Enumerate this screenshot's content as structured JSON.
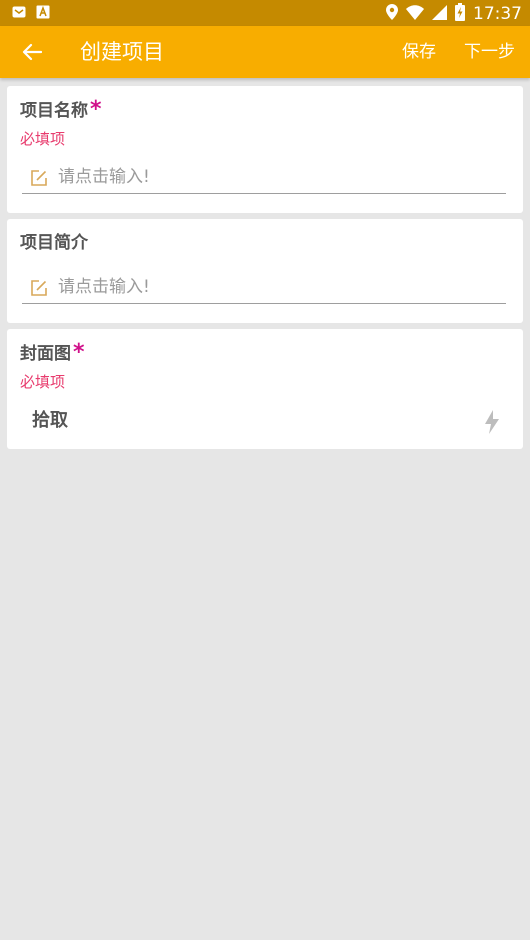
{
  "status_bar": {
    "time": "17:37",
    "icons": [
      "mail-icon",
      "a-box-icon",
      "location-icon",
      "wifi-icon",
      "signal-icon",
      "battery-charging-icon"
    ]
  },
  "app_bar": {
    "back_icon": "arrow-left-icon",
    "title": "创建项目",
    "save_label": "保存",
    "next_label": "下一步"
  },
  "form": {
    "project_name": {
      "label": "项目名称",
      "required_mark": "*",
      "required_hint": "必填项",
      "value": "",
      "placeholder": "请点击输入!"
    },
    "project_intro": {
      "label": "项目简介",
      "value": "",
      "placeholder": "请点击输入!"
    },
    "cover": {
      "label": "封面图",
      "required_mark": "*",
      "required_hint": "必填项",
      "pick_label": "拾取",
      "pick_icon": "lightning-icon"
    }
  },
  "colors": {
    "status_bar": "#c58a00",
    "app_bar": "#f8ad00",
    "background": "#e6e6e6",
    "required_star": "#d0108a",
    "required_hint": "#e83c6e",
    "edit_icon": "#d8a85a"
  }
}
